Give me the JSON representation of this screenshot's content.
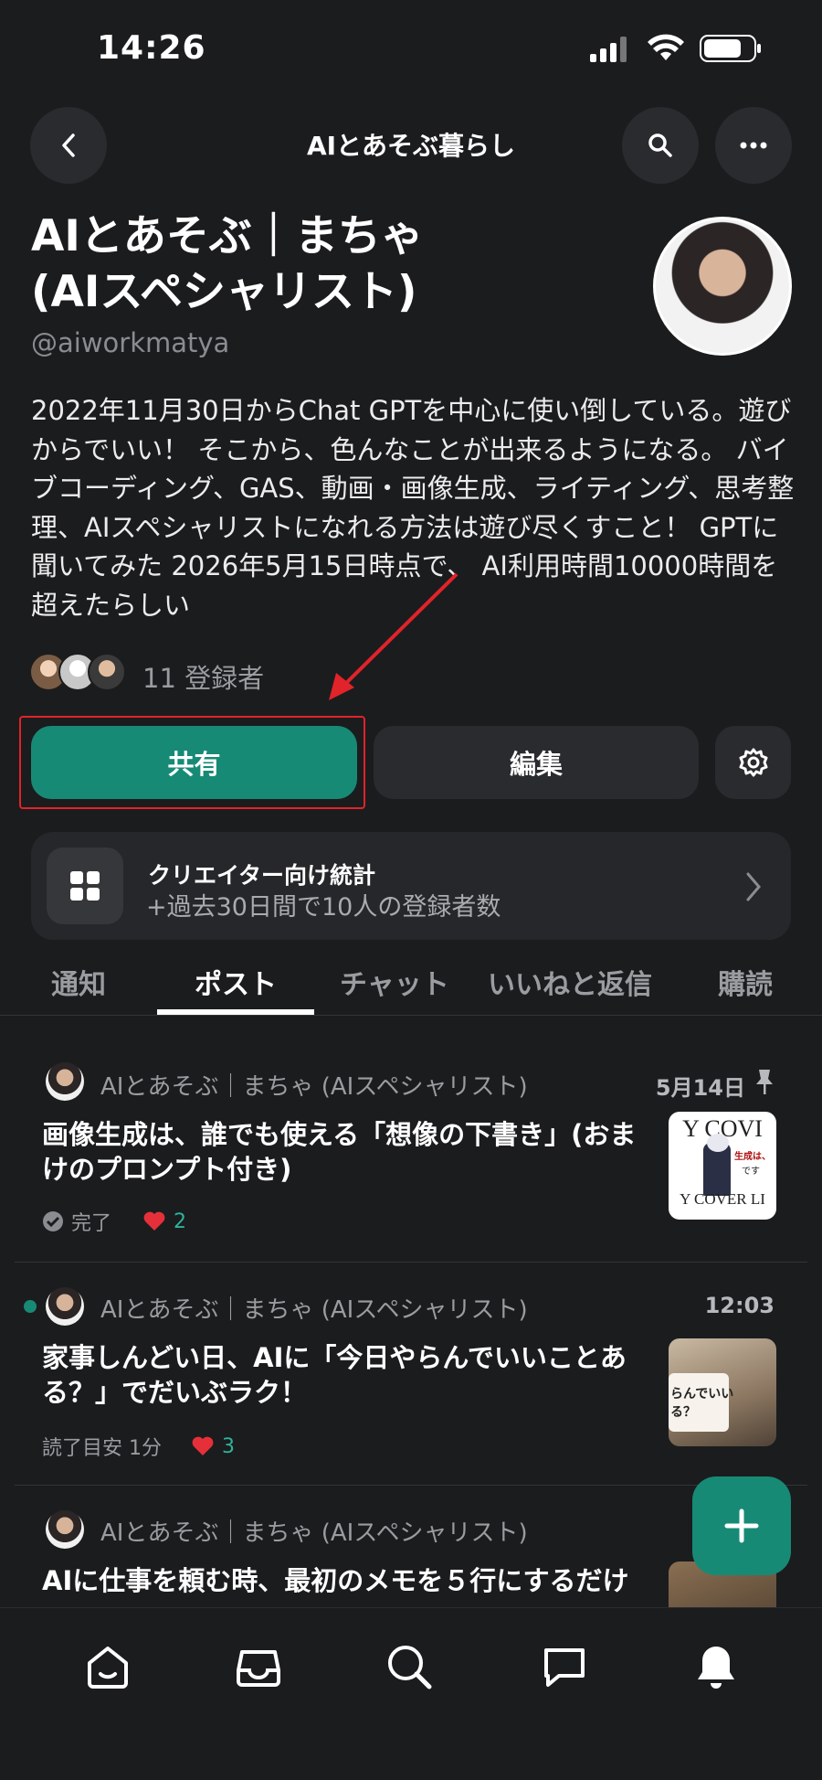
{
  "status_bar": {
    "time": "14:26"
  },
  "header": {
    "title": "AIとあそぶ暮らし"
  },
  "profile": {
    "name": "AIとあそぶ｜まちゃ\n(AIスペシャリスト)",
    "handle": "@aiworkmatya",
    "bio": "2022年11月30日からChat GPTを中心に使い倒している。遊びからでいい！ そこから、色んなことが出来るようになる。 バイブコーディング、GAS、動画・画像生成、ライティング、思考整理、AIスペシャリストになれる方法は遊び尽くすこと！ GPTに聞いてみた 2026年5月15日時点で、 AI利用時間10000時間を超えたらしい",
    "subscribers": "11 登録者"
  },
  "actions": {
    "share_label": "共有",
    "edit_label": "編集"
  },
  "stats_card": {
    "title": "クリエイター向け統計",
    "subtitle": "+過去30日間で10人の登録者数"
  },
  "tabs": [
    {
      "label": "通知"
    },
    {
      "label": "ポスト"
    },
    {
      "label": "チャット"
    },
    {
      "label": "いいねと返信"
    },
    {
      "label": "購読"
    }
  ],
  "posts": [
    {
      "author": "AIとあそぶ｜まちゃ (AIスペシャリスト)",
      "date": "5月14日",
      "title": "画像生成は、誰でも使える「想像の下書き」(おまけのプロンプト付き)",
      "status": "完了",
      "likes": "2"
    },
    {
      "author": "AIとあそぶ｜まちゃ (AIスペシャリスト)",
      "date": "12:03",
      "title": "家事しんどい日、AIに「今日やらんでいいことある？」でだいぶラク！",
      "status": "読了目安 1分",
      "likes": "3"
    },
    {
      "author": "AIとあそぶ｜まちゃ (AIスペシャリスト)",
      "title": "AIに仕事を頼む時、最初のメモを５行にするだけ"
    }
  ],
  "thumbs": {
    "first": [
      "Y COVI",
      "生成は、",
      "です",
      "Y COVER LI"
    ],
    "second": [
      "らんでいい",
      "る？"
    ]
  },
  "colors": {
    "accent": "#178a76",
    "background": "#1b1c1e",
    "highlight": "#e1232a"
  }
}
